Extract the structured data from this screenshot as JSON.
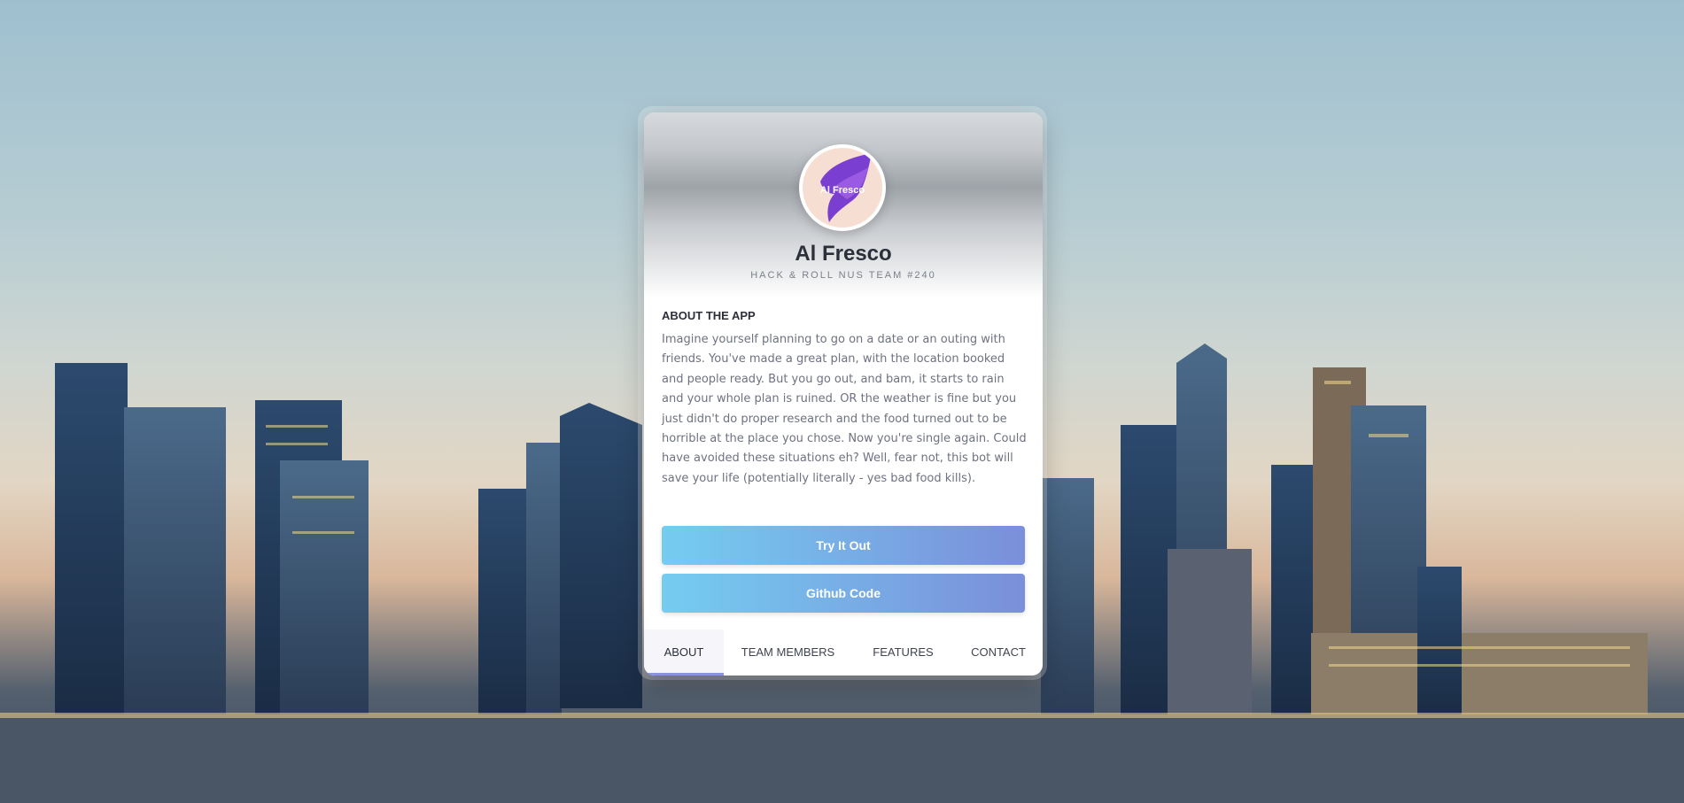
{
  "app": {
    "logo_text": "Al Fresco",
    "title": "Al Fresco",
    "subtitle": "HACK & ROLL NUS TEAM #240"
  },
  "about": {
    "heading": "ABOUT THE APP",
    "description": "Imagine yourself planning to go on a date or an outing with friends. You've made a great plan, with the location booked and people ready. But you go out, and bam, it starts to rain and your whole plan is ruined. OR the weather is fine but you just didn't do proper research and the food turned out to be horrible at the place you chose. Now you're single again. Could have avoided these situations eh? Well, fear not, this bot will save your life (potentially literally - yes bad food kills)."
  },
  "buttons": {
    "try_label": "Try It Out",
    "github_label": "Github Code"
  },
  "tabs": [
    {
      "label": "ABOUT",
      "active": true
    },
    {
      "label": "TEAM MEMBERS",
      "active": false
    },
    {
      "label": "FEATURES",
      "active": false
    },
    {
      "label": "CONTACT",
      "active": false
    }
  ],
  "colors": {
    "button_gradient_start": "#74cdf1",
    "button_gradient_end": "#7b8fda",
    "active_tab_underline": "#8a93de",
    "logo_purple": "#7a3fd0"
  },
  "background": {
    "icon": "city-skyline-photo"
  }
}
